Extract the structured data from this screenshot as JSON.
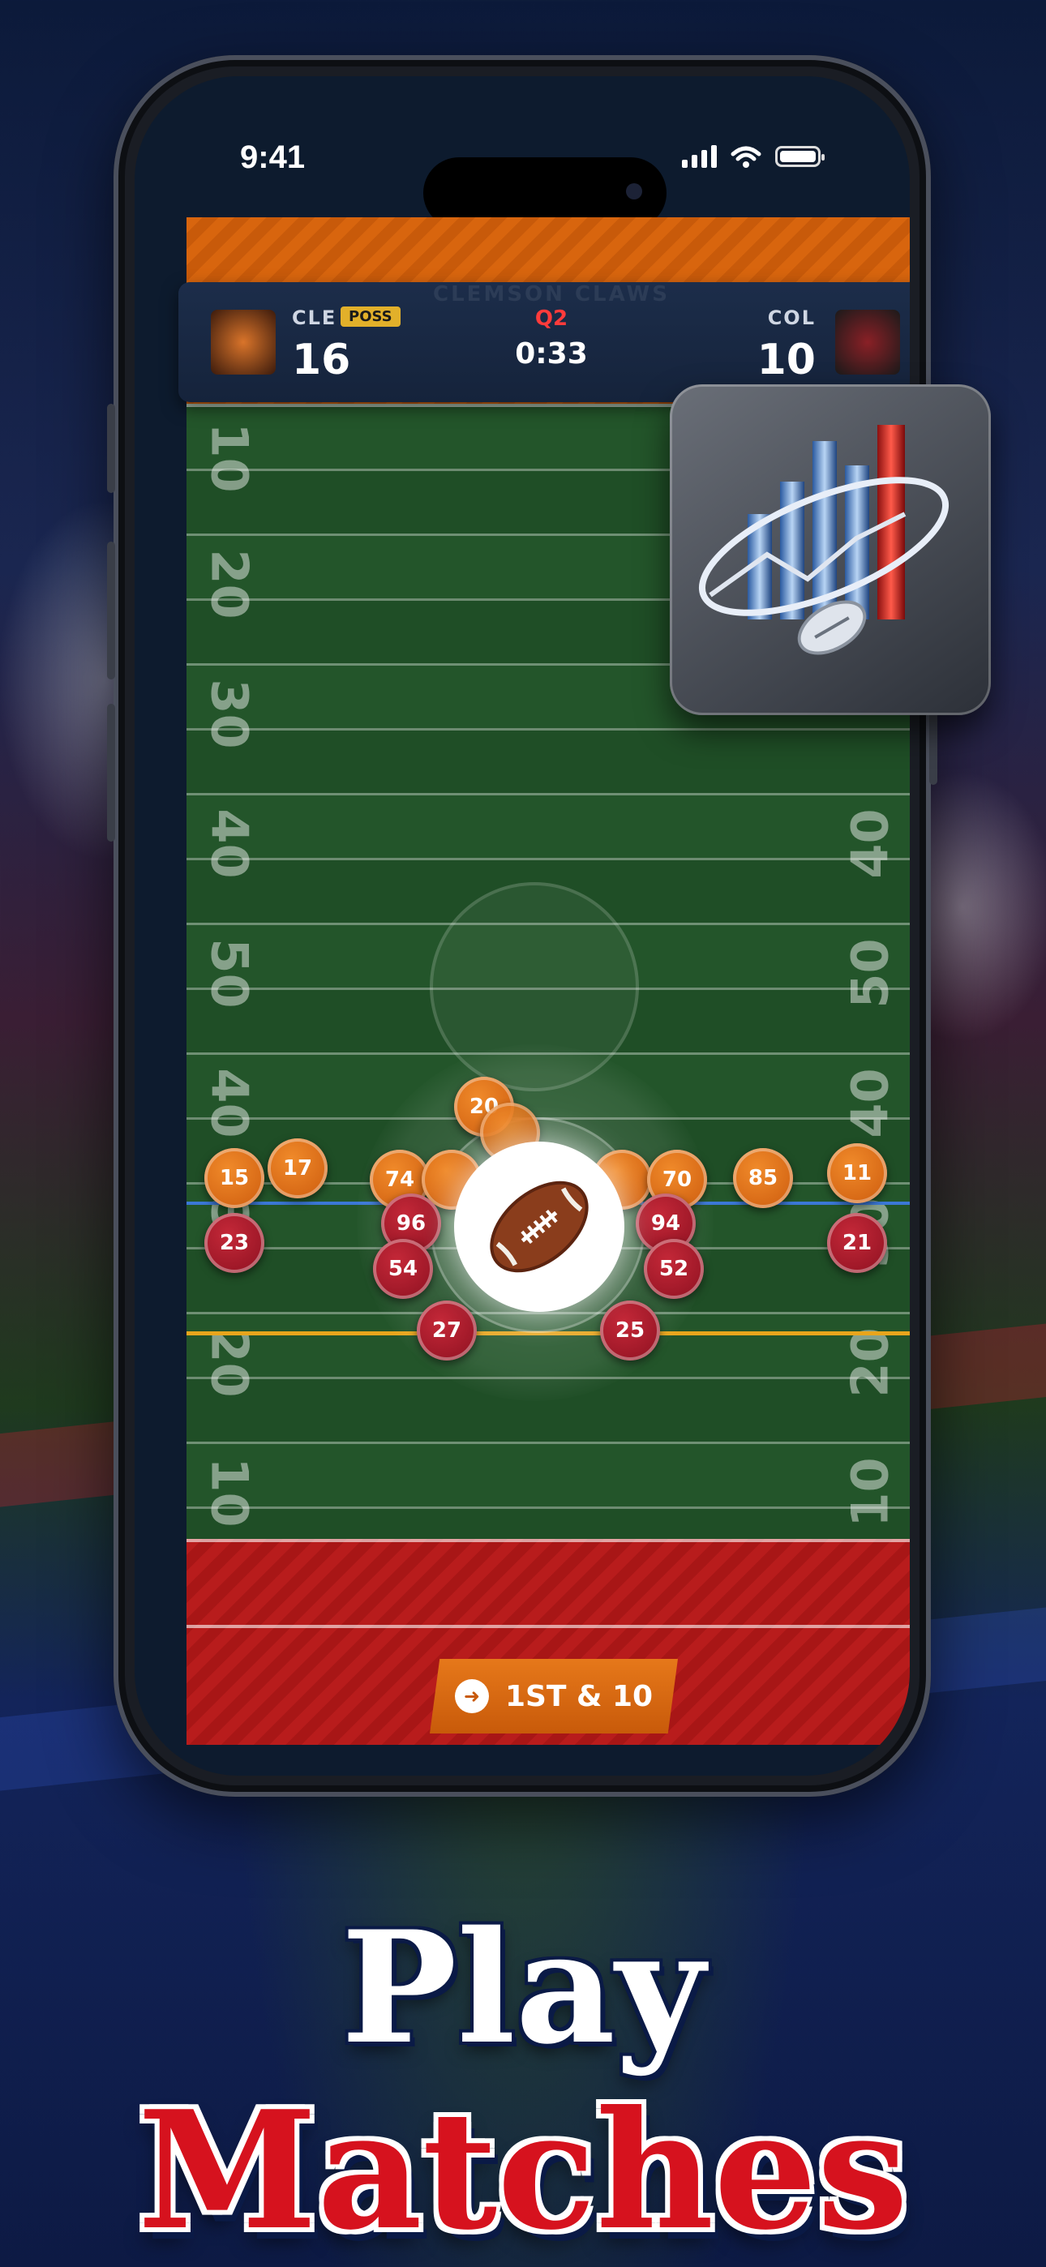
{
  "status_bar": {
    "time": "9:41"
  },
  "scoreboard": {
    "watermark": "CLEMSON CLAWS",
    "home": {
      "abbr": "CLE",
      "score": "16",
      "possession_label": "POSS"
    },
    "away": {
      "abbr": "COL",
      "score": "10"
    },
    "quarter": "Q2",
    "clock": "0:33"
  },
  "field": {
    "yard_numbers_left": [
      "10",
      "20",
      "30",
      "40",
      "50",
      "40",
      "30",
      "20",
      "10"
    ],
    "yard_numbers_right": [
      "40",
      "50",
      "40",
      "30",
      "20",
      "10"
    ]
  },
  "players": {
    "offense": [
      "20",
      "17",
      "15",
      "74",
      "70",
      "85",
      "11"
    ],
    "defense": [
      "23",
      "96",
      "54",
      "27",
      "25",
      "94",
      "52",
      "21"
    ]
  },
  "down_button": {
    "label": "1ST & 10"
  },
  "colors": {
    "offense": "#d8650e",
    "defense": "#a81616",
    "accent": "#e2b02a"
  },
  "headline": {
    "line1": "Play",
    "line2": "Matches"
  }
}
